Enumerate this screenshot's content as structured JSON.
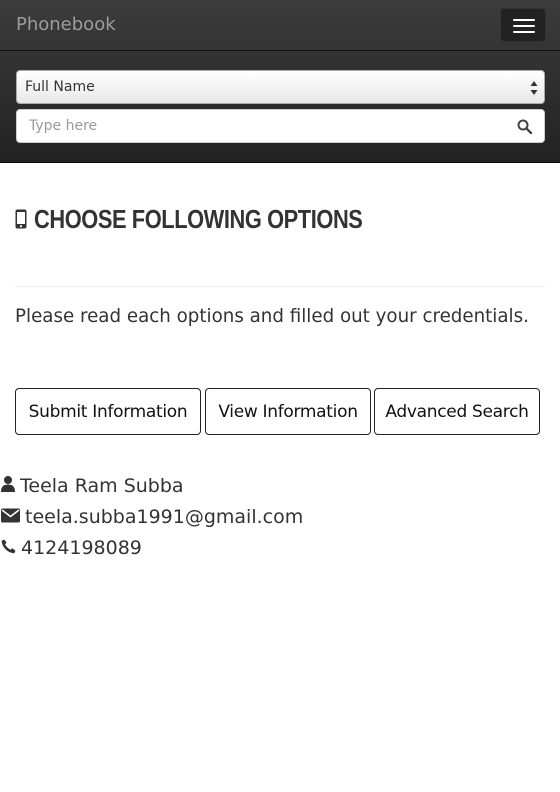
{
  "navbar": {
    "brand": "Phonebook",
    "search_field_select": {
      "selected": "Full Name"
    },
    "search_input": {
      "placeholder": "Type here"
    }
  },
  "main": {
    "heading": "CHOOSE FOLLOWING OPTIONS",
    "lead": "Please read each options and filled out your credentials.",
    "buttons": {
      "submit": "Submit Information",
      "view": "View Information",
      "advanced": "Advanced Search"
    }
  },
  "contact": {
    "name": "Teela Ram Subba",
    "email": "teela.subba1991@gmail.com",
    "phone": "4124198089"
  },
  "icons": {
    "menu": "hamburger-menu-icon",
    "select_arrows": "up-down-arrows-icon",
    "search": "search-icon",
    "heading": "mobile-phone-icon",
    "name": "user-icon",
    "email": "envelope-icon",
    "phone": "phone-icon"
  },
  "colors": {
    "navbar_bg": "#222222",
    "brand_text": "#9d9d9d",
    "text": "#333333"
  }
}
